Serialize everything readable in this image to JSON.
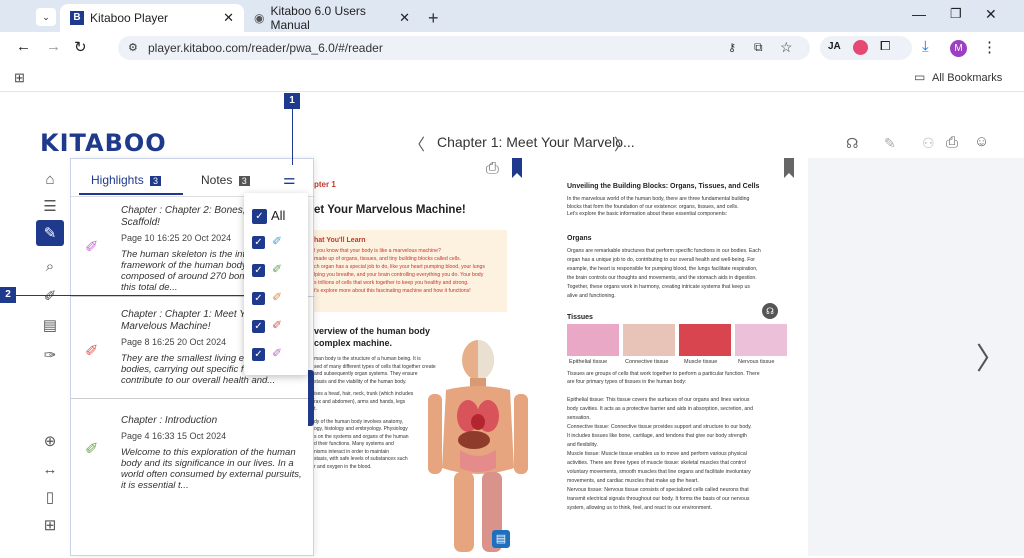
{
  "browser": {
    "tabs": [
      {
        "title": "Kitaboo Player",
        "favicon": "B",
        "active": true
      },
      {
        "title": "Kitaboo 6.0 Users Manual",
        "favicon": "globe",
        "active": false
      }
    ],
    "new_tab": "+",
    "url": "player.kitaboo.com/reader/pwa_6.0/#/reader",
    "profile_initial": "M",
    "extension_initials": "JA",
    "bookmarks_label": "All Bookmarks"
  },
  "app": {
    "logo": "KITABOO",
    "chapter_title": "Chapter 1: Meet Your Marvelo...",
    "accent": "#1f3a8c"
  },
  "callouts": [
    "1",
    "2"
  ],
  "panel": {
    "tab_highlights": "Highlights",
    "highlights_count": "3",
    "tab_notes": "Notes",
    "notes_count": "3",
    "items": [
      {
        "chapter": "Chapter : Chapter 2: Bones, the Sturdy Scaffold!",
        "meta": "Page 10   16:25 20 Oct 2024",
        "text": "The human skeleton is the internal framework of the human body. It is composed of around 270 bones at birth – this total de...",
        "color": "#c76ad6"
      },
      {
        "chapter": "Chapter : Chapter 1: Meet Your Marvelous Machine!",
        "meta": "Page 8   16:25 20 Oct 2024",
        "text": "They are the smallest living entities in our bodies, carrying out specific functions that contribute to our overall health and...",
        "color": "#e05a5a"
      },
      {
        "chapter": "Chapter : Introduction",
        "meta": "Page 4   16:33 15 Oct 2024",
        "text": "Welcome to this exploration of the human body and its significance in our lives. In a world often consumed by external pursuits, it is essential t...",
        "color": "#6aa84f"
      }
    ]
  },
  "filter": {
    "all_label": "All",
    "pen_colors": [
      "#4aa3df",
      "#6aa84f",
      "#e69138",
      "#e05a5a",
      "#c76ad6"
    ]
  },
  "book": {
    "left": {
      "chapter_label": "pter 1",
      "title": "et Your Marvelous Machine!",
      "learn_title": "hat You'll Learn",
      "learn_lines": [
        "l you know that your body is like a marvelous machine?",
        "made up of organs, tissues, and tiny building blocks called cells.",
        "ch organ has a special job to do, like your heart pumping blood, your lungs",
        "lping you breathe, and your brain controlling everything you do. Your body",
        "s trillions of cells that work together to keep you healthy and strong.",
        "t's explore more about this fascinating machine and how it functions!"
      ],
      "overview_title_1": "verview of the human body",
      "overview_title_2": "complex machine.",
      "body_lines": [
        "man body is the structure of a human being. It is",
        "sed of many different types of cells that together create",
        "and subsequently organ systems. They ensure",
        "stasis and the viability of the human body.",
        "",
        "ises a head, hair, neck, trunk (which includes",
        "rax and abdomen), arms and hands, legs",
        "t.",
        "",
        "dy of the human body involves anatomy,",
        "ogy, histology and embryology. Physiology",
        "s on the systems and organs of the human",
        "d their functions. Many systems and",
        "nisms interact in order to maintain",
        "stasis, with safe levels of substances such",
        "r and oxygen in the blood."
      ]
    },
    "right": {
      "title": "Unveiling the Building Blocks: Organs, Tissues, and Cells",
      "intro": [
        "In the marvelous world of the human body, there are three fundamental building",
        "blocks that form the foundation of our existence: organs, tissues, and cells.",
        "Let's explore the basic information about these essential components:"
      ],
      "organs_title": "Organs",
      "organs_lines": [
        "Organs are remarkable structures that perform specific functions in our bodies. Each",
        "organ has a unique job to do, contributing to our overall health and well-being. For",
        "example, the heart is responsible for pumping blood, the lungs facilitate respiration,",
        "the brain controls our thoughts and movements, and the stomach aids in digestion.",
        "Together, these organs work in harmony, creating intricate systems that keep us",
        "alive and functioning."
      ],
      "tissues_title": "Tissues",
      "tissue_captions": [
        "Epithelial tissue",
        "Connective tissue",
        "Muscle tissue",
        "Nervous tissue"
      ],
      "tissue_lines": [
        "Tissues are groups of cells that work together to perform a particular function. There",
        "are four primary types of tissues in the human body:"
      ],
      "types_lines": [
        "Epithelial tissue: This tissue covers the surfaces of our organs and lines various",
        "body cavities. It acts as a protective barrier and aids in absorption, secretion, and",
        "sensation.",
        "Connective tissue: Connective tissue provides support and structure to our body.",
        "It includes tissues like bone, cartilage, and tendons that give our body strength",
        "and flexibility.",
        "Muscle tissue: Muscle tissue enables us to move and perform various physical",
        "activities. There are three types of muscle tissue: skeletal muscles that control",
        "voluntary movements, smooth muscles that line organs and facilitate involuntary",
        "movements, and cardiac muscles that make up the heart.",
        "Nervous tissue: Nervous tissue consists of specialized cells called neurons that",
        "transmit electrical signals throughout our body. It forms the basis of our nervous",
        "system, allowing us to think, feel, and react to our environment."
      ]
    }
  }
}
